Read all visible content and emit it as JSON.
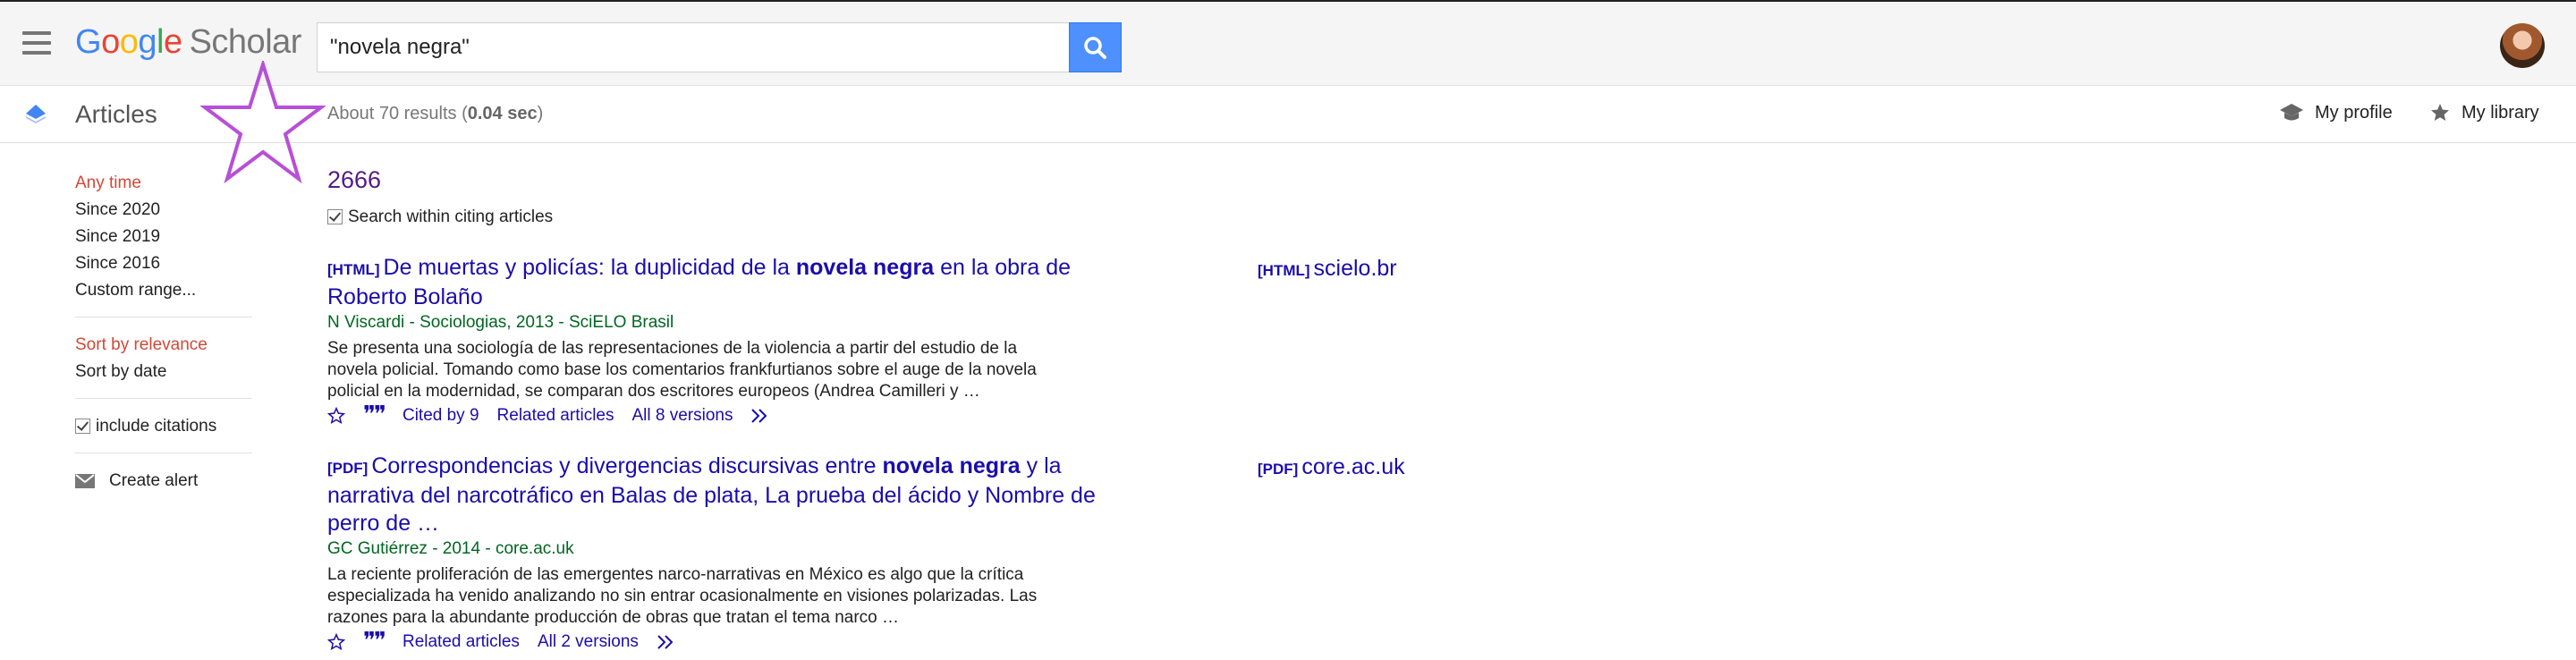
{
  "header": {
    "logo": {
      "g1": "G",
      "o1": "o",
      "o2": "o",
      "g2": "g",
      "l": "l",
      "e": "e",
      "suffix": "Scholar"
    },
    "search_query": "\"novela negra\""
  },
  "subbar": {
    "section_title": "Articles",
    "results_prefix": "About 70 results (",
    "results_time": "0.04 sec",
    "results_suffix": ")",
    "my_profile": "My profile",
    "my_library": "My library"
  },
  "sidebar": {
    "time_filters": [
      "Any time",
      "Since 2020",
      "Since 2019",
      "Since 2016",
      "Custom range..."
    ],
    "selected_time": "Any time",
    "sort_options": [
      "Sort by relevance",
      "Sort by date"
    ],
    "include_citations": "include citations",
    "create_alert": "Create alert"
  },
  "main": {
    "query_title": "2666",
    "search_within": "Search within citing articles",
    "results": [
      {
        "tag": "[HTML]",
        "title_parts": [
          "De muertas y policías: la duplicidad de la ",
          "novela negra",
          " en la obra de Roberto Bolaño"
        ],
        "meta": "N Viscardi - Sociologias, 2013 - SciELO Brasil",
        "snippet": "Se presenta una sociología de las representaciones de la violencia a partir del estudio de la novela policial. Tomando como base los comentarios frankfurtianos sobre el auge de la novela policial en la modernidad, se comparan dos escritores europeos (Andrea Camilleri y …",
        "links": [
          "Cited by 9",
          "Related articles",
          "All 8 versions"
        ],
        "side_tag": "[HTML]",
        "side_source": "scielo.br"
      },
      {
        "tag": "[PDF]",
        "title_parts": [
          "Correspondencias y divergencias discursivas entre ",
          "novela negra",
          " y la narrativa del narcotráfico en Balas de plata, La prueba del ácido y Nombre de perro de …"
        ],
        "meta": "GC Gutiérrez - 2014 - core.ac.uk",
        "snippet": "La reciente proliferación de las emergentes narco-narrativas en México es algo que la crítica especializada ha venido analizando no sin entrar ocasionalmente en visiones polarizadas. Las razones para la abundante producción de obras que tratan el tema narco …",
        "links": [
          "Related articles",
          "All 2 versions"
        ],
        "side_tag": "[PDF]",
        "side_source": "core.ac.uk"
      }
    ]
  },
  "colors": {
    "accent_blue": "#4d90fe",
    "link": "#1a0dab",
    "selected": "#d14836",
    "meta_green": "#006621",
    "overlay_star": "#b84fd8"
  }
}
